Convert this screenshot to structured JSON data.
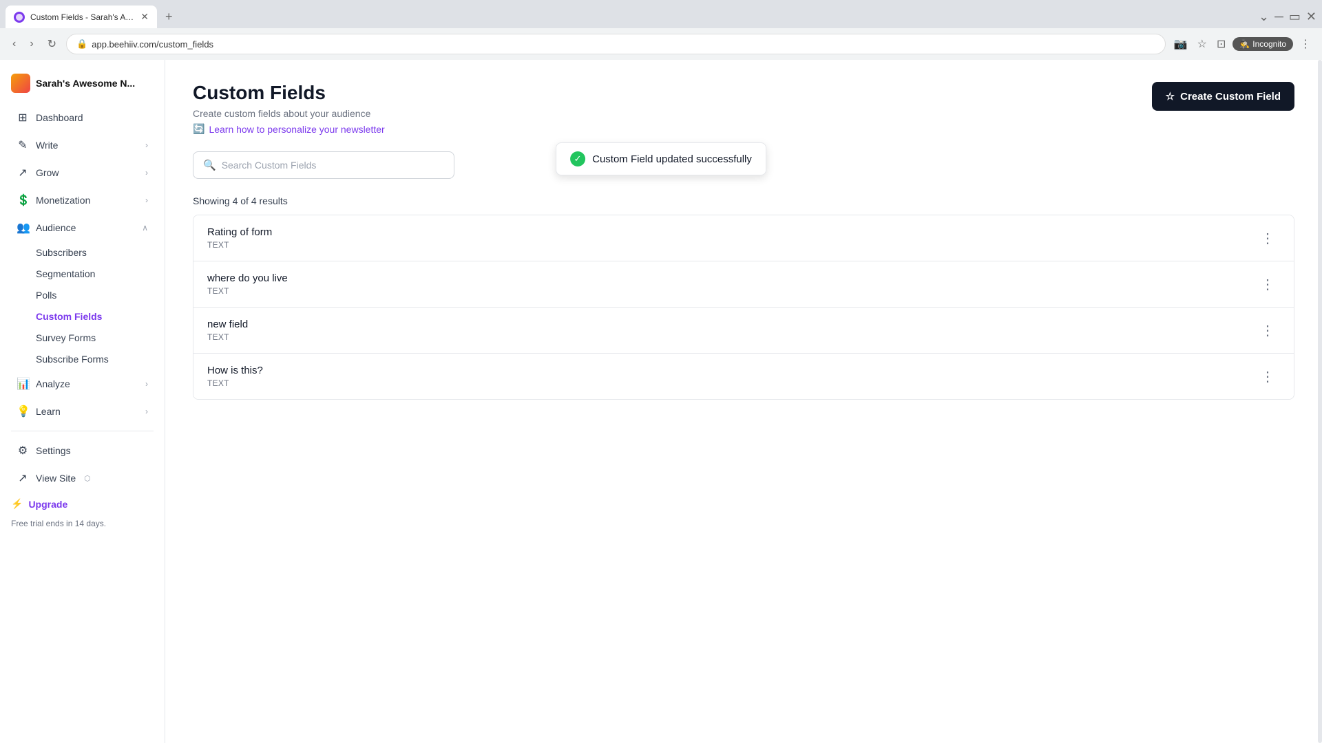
{
  "browser": {
    "tab_title": "Custom Fields - Sarah's Aweso...",
    "url": "app.beehiiv.com/custom_fields",
    "incognito_label": "Incognito",
    "new_tab_label": "+"
  },
  "toast": {
    "message": "Custom Field updated successfully"
  },
  "sidebar": {
    "workspace_name": "Sarah's Awesome N...",
    "items": {
      "dashboard": "Dashboard",
      "write": "Write",
      "grow": "Grow",
      "monetization": "Monetization",
      "audience": "Audience",
      "analyze": "Analyze",
      "learn": "Learn",
      "settings": "Settings",
      "view_site": "View Site",
      "upgrade": "Upgrade"
    },
    "audience_sub": {
      "subscribers": "Subscribers",
      "segmentation": "Segmentation",
      "polls": "Polls",
      "custom_fields": "Custom Fields",
      "survey_forms": "Survey Forms",
      "subscribe_forms": "Subscribe Forms"
    },
    "free_trial": "Free trial ends in 14 days."
  },
  "page": {
    "title": "Custom Fields",
    "subtitle": "Create custom fields about your audience",
    "learn_link": "Learn how to personalize your newsletter",
    "create_button": "Create Custom Field",
    "search_placeholder": "Search Custom Fields",
    "results_text": "Showing 4 of 4 results"
  },
  "fields": [
    {
      "name": "Rating of form",
      "type": "TEXT"
    },
    {
      "name": "where do you live",
      "type": "TEXT"
    },
    {
      "name": "new field",
      "type": "TEXT"
    },
    {
      "name": "How is this?",
      "type": "TEXT"
    }
  ]
}
